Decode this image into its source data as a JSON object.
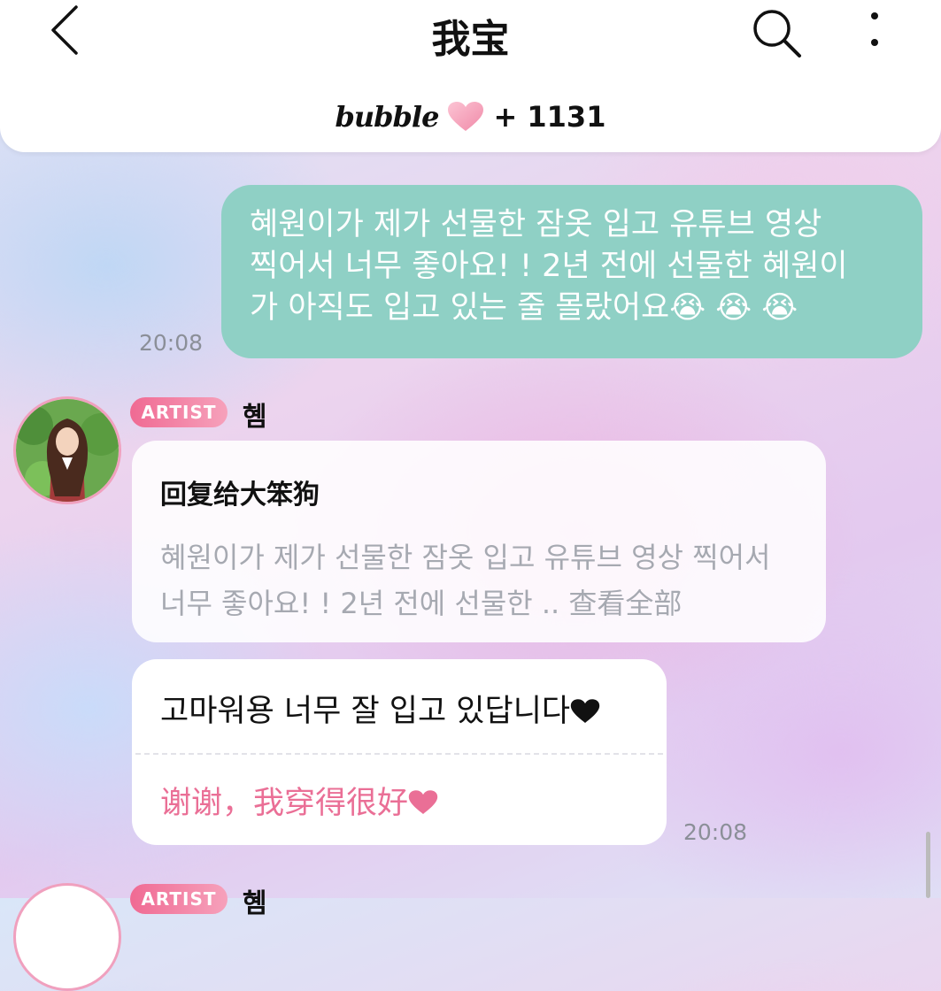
{
  "header": {
    "title": "我宝",
    "brand": "bubble",
    "count": "+ 1131"
  },
  "messages": {
    "outgoing": {
      "lines": [
        "혜원이가 제가 선물한 잠옷 입고 유튜브 영상",
        "찍어서 너무 좋아요! ! 2년 전에 선물한 혜원이",
        "가 아직도 입고 있는 줄 몰랐어요😭 😭 😭"
      ],
      "time": "20:08"
    },
    "artist": {
      "badge": "ARTIST",
      "name": "혬",
      "reply_to": "回复给大笨狗",
      "quote_lines": [
        "혜원이가 제가 선물한 잠옷 입고 유튜브 영상 찍어서",
        "너무 좋아요! ! 2년 전에 선물한 .. 查看全部"
      ],
      "original": "고마워용 너무 잘 입고 있답니다",
      "translation": "谢谢，我穿得很好",
      "time": "20:08"
    },
    "next": {
      "badge": "ARTIST",
      "name": "혬"
    }
  },
  "colors": {
    "outgoing_bubble": "#8fd0c5",
    "artist_badge": "#f06a93",
    "translation_text": "#ea6f96",
    "time_text": "#8b8f98"
  },
  "icons": {
    "back": "chevron-left-icon",
    "search": "search-icon",
    "more": "more-vertical-icon",
    "brand_heart": "heart-icon"
  }
}
